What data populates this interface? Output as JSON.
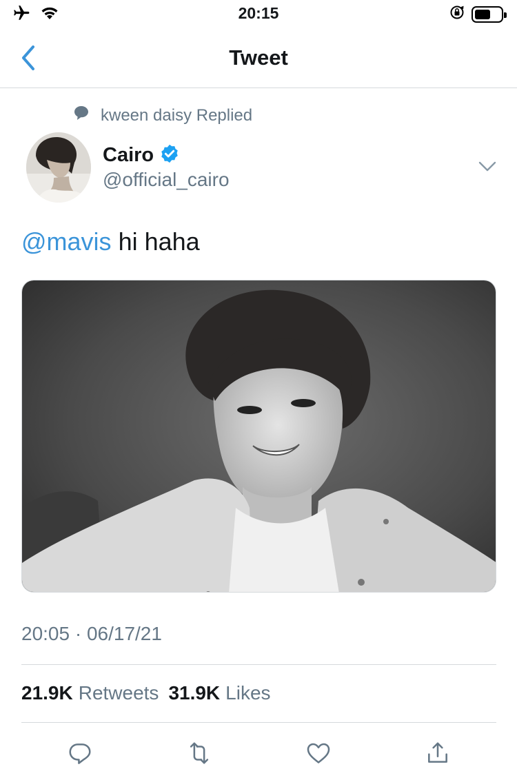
{
  "status_bar": {
    "time": "20:15",
    "icons": [
      "airplane-icon",
      "wifi-icon",
      "orientation-lock-icon",
      "battery-icon"
    ]
  },
  "nav": {
    "title": "Tweet",
    "back_icon": "chevron-left-icon"
  },
  "reply_context": {
    "text": "kween daisy Replied",
    "icon": "speech-bubble-icon"
  },
  "author": {
    "name": "Cairo",
    "handle": "@official_cairo",
    "verified": true
  },
  "tweet": {
    "mention": "@mavis",
    "text": " hi haha",
    "timestamp": "20:05 · 06/17/21"
  },
  "stats": {
    "retweets_count": "21.9K",
    "retweets_label": "Retweets",
    "likes_count": "31.9K",
    "likes_label": "Likes"
  },
  "actions": [
    "reply-icon",
    "retweet-icon",
    "like-icon",
    "share-icon"
  ],
  "colors": {
    "accent": "#3b94d9",
    "secondary_text": "#657786",
    "divider": "#d5d9dc",
    "verified": "#1da1f2"
  }
}
